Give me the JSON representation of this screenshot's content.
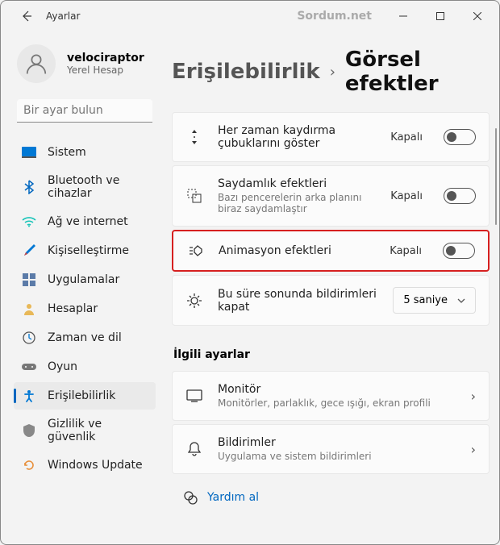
{
  "window": {
    "title": "Ayarlar",
    "watermark": "Sordum.net"
  },
  "profile": {
    "name": "velociraptor",
    "sub": "Yerel Hesap"
  },
  "search": {
    "placeholder": "Bir ayar bulun"
  },
  "nav": [
    {
      "label": "Sistem"
    },
    {
      "label": "Bluetooth ve cihazlar"
    },
    {
      "label": "Ağ ve internet"
    },
    {
      "label": "Kişiselleştirme"
    },
    {
      "label": "Uygulamalar"
    },
    {
      "label": "Hesaplar"
    },
    {
      "label": "Zaman ve dil"
    },
    {
      "label": "Oyun"
    },
    {
      "label": "Erişilebilirlik"
    },
    {
      "label": "Gizlilik ve güvenlik"
    },
    {
      "label": "Windows Update"
    }
  ],
  "breadcrumb": {
    "parent": "Erişilebilirlik",
    "current": "Görsel efektler"
  },
  "settings": [
    {
      "title": "Her zaman kaydırma çubuklarını göster",
      "sub": "",
      "value": "Kapalı"
    },
    {
      "title": "Saydamlık efektleri",
      "sub": "Bazı pencerelerin arka planını biraz saydamlaştır",
      "value": "Kapalı"
    },
    {
      "title": "Animasyon efektleri",
      "sub": "",
      "value": "Kapalı"
    },
    {
      "title": "Bu süre sonunda bildirimleri kapat",
      "sub": "",
      "select": "5 saniye"
    }
  ],
  "related": {
    "header": "İlgili ayarlar",
    "items": [
      {
        "title": "Monitör",
        "sub": "Monitörler, parlaklık, gece ışığı, ekran profili"
      },
      {
        "title": "Bildirimler",
        "sub": "Uygulama ve sistem bildirimleri"
      }
    ]
  },
  "help": {
    "label": "Yardım al"
  }
}
